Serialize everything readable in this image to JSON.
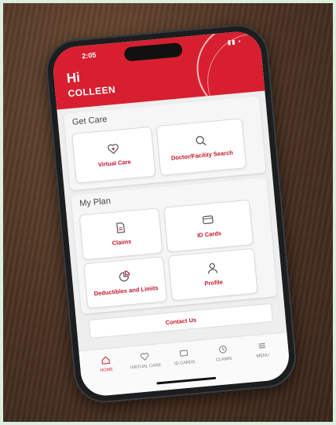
{
  "status": {
    "time": "2:05",
    "icons": "▮▮ •"
  },
  "header": {
    "greeting": "Hi",
    "name": "COLLEEN"
  },
  "get_care": {
    "title": "Get Care",
    "tiles": [
      {
        "label": "Virtual Care",
        "icon": "heart-plus-icon"
      },
      {
        "label": "Doctor/Facility Search",
        "icon": "search-icon"
      }
    ]
  },
  "my_plan": {
    "title": "My Plan",
    "tiles": [
      {
        "label": "Claims",
        "icon": "document-icon"
      },
      {
        "label": "ID Cards",
        "icon": "card-icon"
      },
      {
        "label": "Deductibles and Limits",
        "icon": "pie-icon"
      },
      {
        "label": "Profile",
        "icon": "person-icon"
      }
    ]
  },
  "contact": {
    "label": "Contact Us"
  },
  "tabs": [
    {
      "label": "HOME",
      "icon": "home-icon",
      "active": true
    },
    {
      "label": "VIRTUAL CARE",
      "icon": "heart-icon"
    },
    {
      "label": "ID CARDS",
      "icon": "card-icon"
    },
    {
      "label": "CLAIMS",
      "icon": "claims-icon"
    },
    {
      "label": "MENU",
      "icon": "menu-icon"
    }
  ],
  "colors": {
    "brand": "#d71f30",
    "accent_text": "#c3162a"
  }
}
